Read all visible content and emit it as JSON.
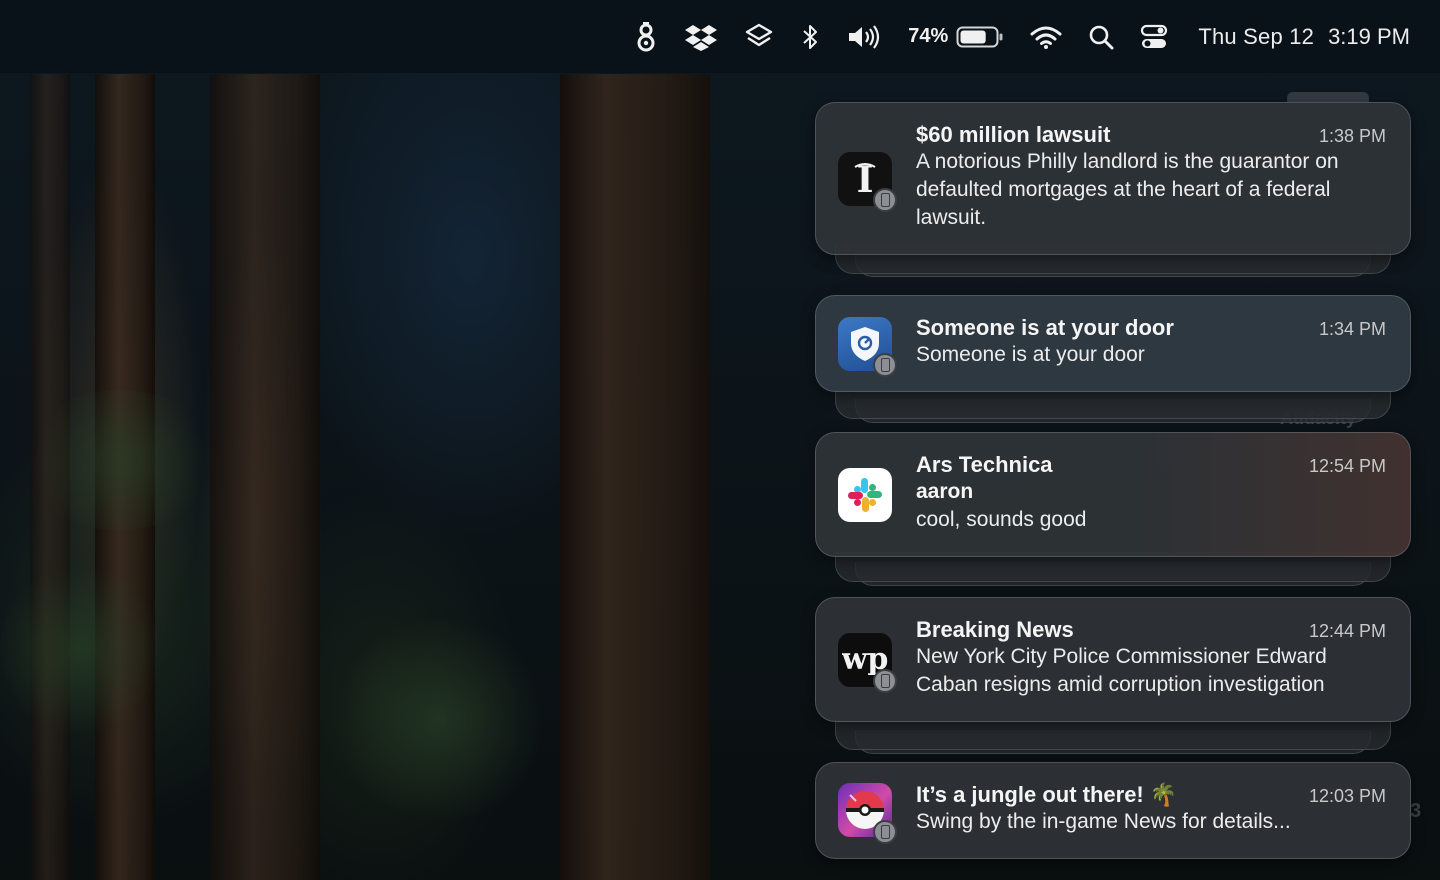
{
  "menubar": {
    "icons": [
      "gpg-keychain-icon",
      "dropbox-icon",
      "layers-icon",
      "bluetooth-icon",
      "volume-icon"
    ],
    "battery_percent": "74%",
    "battery_level": 0.74,
    "status_icons": [
      "wifi-icon",
      "spotlight-search-icon",
      "control-center-icon"
    ],
    "date": "Thu Sep 12",
    "time": "3:19 PM"
  },
  "notifications": [
    {
      "app_icon": "inquirer-logo-icon",
      "title": "$60 million lawsuit",
      "time": "1:38 PM",
      "body": "A notorious Philly landlord is the guarantor on defaulted mortgages at the heart of a federal lawsuit."
    },
    {
      "app_icon": "security-shield-icon",
      "title": "Someone is at your door",
      "time": "1:34 PM",
      "body": "Someone is at your door"
    },
    {
      "app_icon": "slack-icon",
      "title": "Ars Technica",
      "subtitle": "aaron",
      "time": "12:54 PM",
      "body": "cool, sounds good"
    },
    {
      "app_icon": "washington-post-icon",
      "title": "Breaking News",
      "time": "12:44 PM",
      "body": "New York City Police Commissioner Edward Caban resigns amid corruption investigation"
    },
    {
      "app_icon": "pokeball-game-icon",
      "title": "It’s a jungle out there! 🌴",
      "time": "12:03 PM",
      "body": "Swing by the in-game News for details..."
    }
  ],
  "background_peek_text": "Audacity",
  "background_peek_digit": "3"
}
